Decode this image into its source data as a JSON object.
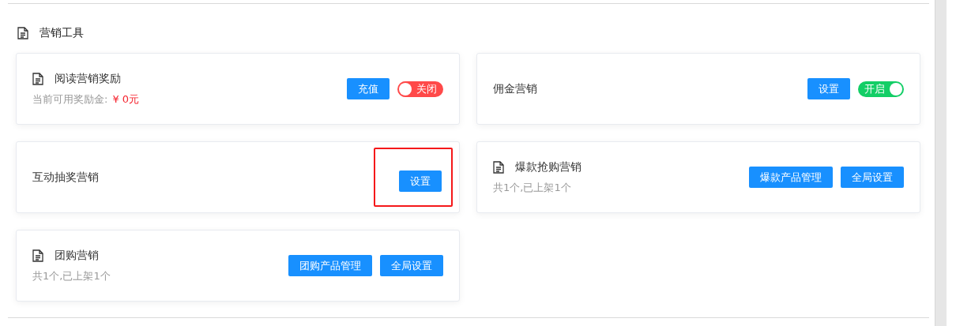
{
  "section": {
    "title": "营销工具"
  },
  "cards": [
    {
      "icon": true,
      "title": "阅读营销奖励",
      "subtitle": "当前可用奖励金:",
      "amount": "¥ 0元",
      "buttons": [
        {
          "label": "充值",
          "highlighted": false
        }
      ],
      "toggle": {
        "on": false,
        "label": "关闭"
      }
    },
    {
      "icon": false,
      "title": "佣金营销",
      "buttons": [
        {
          "label": "设置",
          "highlighted": false
        }
      ],
      "toggle": {
        "on": true,
        "label": "开启"
      }
    },
    {
      "icon": false,
      "title": "互动抽奖营销",
      "buttons": [
        {
          "label": "设置",
          "highlighted": true
        }
      ]
    },
    {
      "icon": true,
      "title": "爆款抢购营销",
      "subtitle": "共1个,已上架1个",
      "buttons": [
        {
          "label": "爆款产品管理",
          "highlighted": false
        },
        {
          "label": "全局设置",
          "highlighted": false
        }
      ]
    },
    {
      "icon": true,
      "title": "团购营销",
      "subtitle": "共1个,已上架1个",
      "buttons": [
        {
          "label": "团购产品管理",
          "highlighted": false
        },
        {
          "label": "全局设置",
          "highlighted": false
        }
      ]
    }
  ]
}
